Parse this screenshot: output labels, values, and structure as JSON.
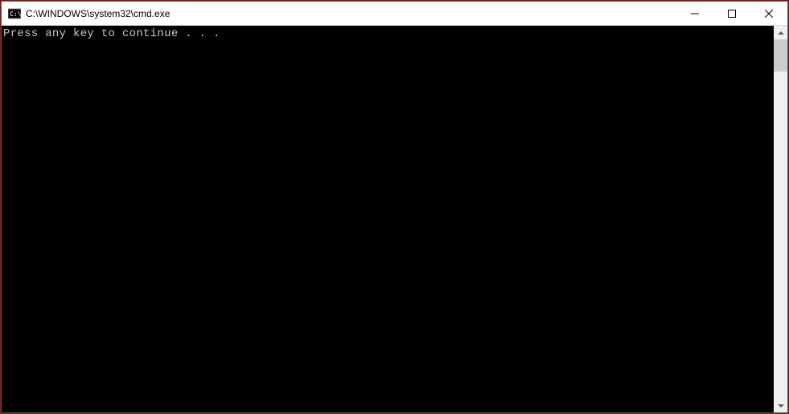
{
  "window": {
    "title": "C:\\WINDOWS\\system32\\cmd.exe"
  },
  "console": {
    "output": "Press any key to continue . . ."
  }
}
